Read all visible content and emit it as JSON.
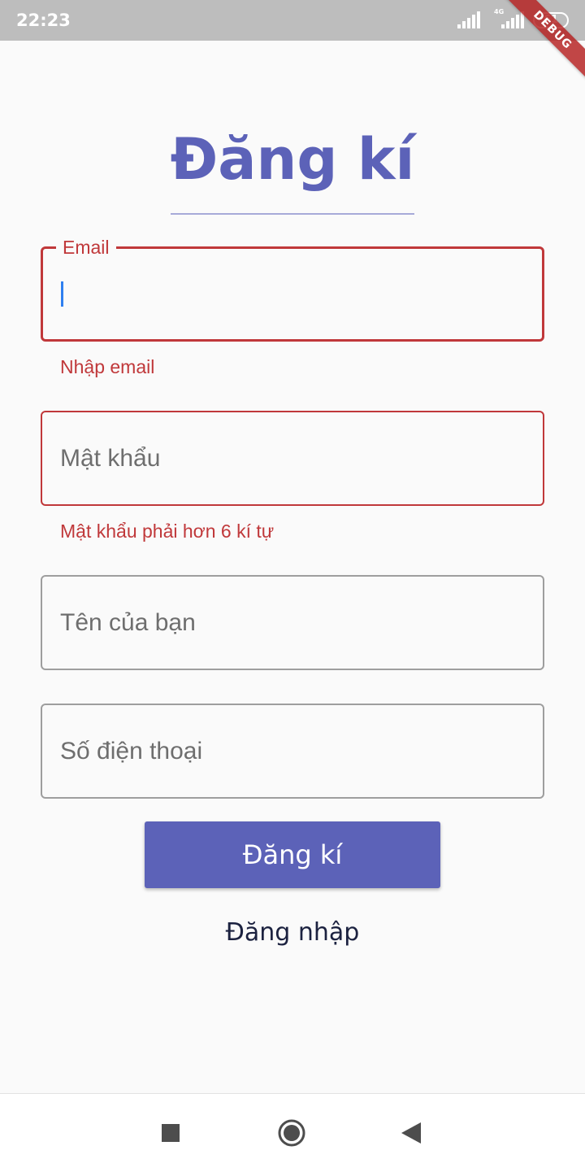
{
  "status_bar": {
    "time": "22:23",
    "network_label": "4G",
    "battery_level": "61",
    "icons": [
      "cell-signal-icon",
      "cell-signal-4g-icon",
      "battery-icon"
    ]
  },
  "debug_banner": "DEBUG",
  "title": "Đăng kí",
  "form": {
    "email": {
      "label": "Email",
      "value": "",
      "error": "Nhập email",
      "focused": true
    },
    "password": {
      "placeholder": "Mật khẩu",
      "value": "",
      "error": "Mật khẩu phải hơn 6 kí tự"
    },
    "name": {
      "placeholder": "Tên của bạn",
      "value": ""
    },
    "phone": {
      "placeholder": "Số điện thoại",
      "value": ""
    }
  },
  "register_button_label": "Đăng kí",
  "login_link_label": "Đăng nhập",
  "nav_bar": {
    "icons": [
      "recent-apps-icon",
      "home-icon",
      "back-icon"
    ]
  },
  "colors": {
    "primary": "#5c62b8",
    "error": "#c0383a",
    "status_bar": "#bdbdbd",
    "background": "#fafafa",
    "link_text": "#1c2240"
  }
}
